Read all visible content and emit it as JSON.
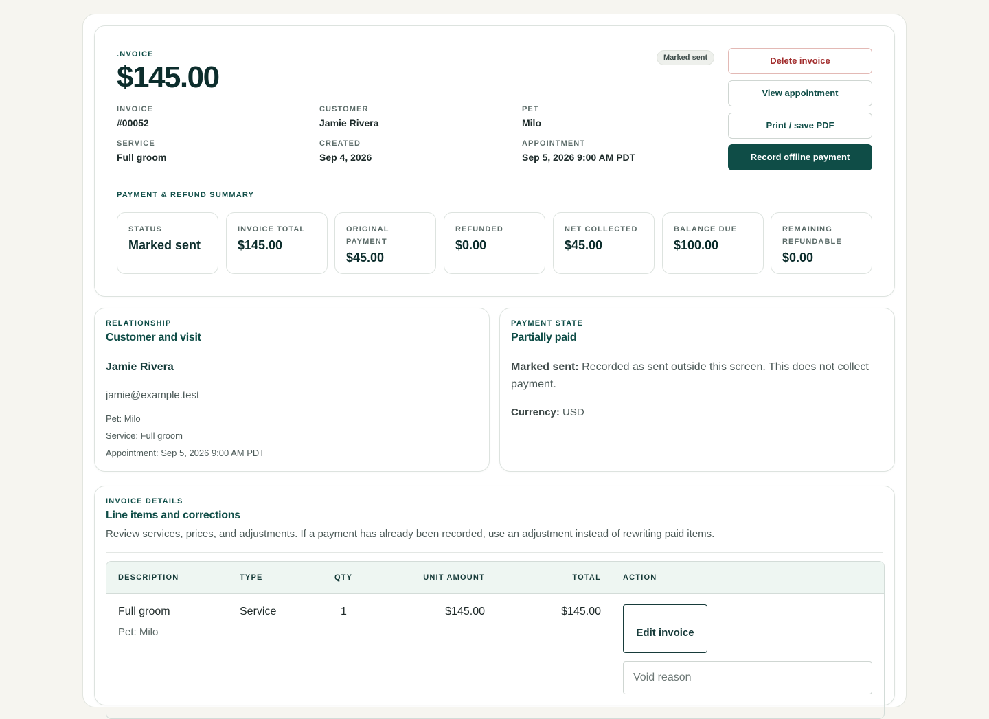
{
  "header": {
    "kicker": ".NVOICE",
    "amount": "$145.00",
    "status_badge": "Marked sent",
    "fields": [
      {
        "label": "INVOICE",
        "value": "#00052"
      },
      {
        "label": "CUSTOMER",
        "value": "Jamie Rivera"
      },
      {
        "label": "PET",
        "value": "Milo"
      },
      {
        "label": "SERVICE",
        "value": "Full groom"
      },
      {
        "label": "CREATED",
        "value": "Sep 4, 2026"
      },
      {
        "label": "APPOINTMENT",
        "value": "Sep 5, 2026 9:00 AM PDT"
      }
    ],
    "actions": {
      "delete": "Delete invoice",
      "view": "View appointment",
      "print": "Print / save PDF",
      "record": "Record offline payment"
    }
  },
  "summary": {
    "title": "PAYMENT & REFUND SUMMARY",
    "stats": [
      {
        "label": "STATUS",
        "value": "Marked sent"
      },
      {
        "label": "INVOICE TOTAL",
        "value": "$145.00"
      },
      {
        "label": "ORIGINAL PAYMENT",
        "value": "$45.00"
      },
      {
        "label": "REFUNDED",
        "value": "$0.00"
      },
      {
        "label": "NET COLLECTED",
        "value": "$45.00"
      },
      {
        "label": "BALANCE DUE",
        "value": "$100.00"
      },
      {
        "label": "REMAINING REFUNDABLE",
        "value": "$0.00"
      }
    ]
  },
  "relationship": {
    "eyebrow": "RELATIONSHIP",
    "title": "Customer and visit",
    "name": "Jamie Rivera",
    "email": "jamie@example.test",
    "pet": "Pet: Milo",
    "service": "Service: Full groom",
    "appointment": "Appointment: Sep 5, 2026 9:00 AM PDT"
  },
  "payment_state": {
    "eyebrow": "PAYMENT STATE",
    "title": "Partially paid",
    "note_label": "Marked sent:",
    "note_text": " Recorded as sent outside this screen. This does not collect payment.",
    "currency_label": "Currency:",
    "currency_value": " USD"
  },
  "details": {
    "eyebrow": "INVOICE DETAILS",
    "title": "Line items and corrections",
    "description": "Review services, prices, and adjustments. If a payment has already been recorded, use an adjustment instead of rewriting paid items.",
    "columns": [
      "DESCRIPTION",
      "TYPE",
      "QTY",
      "UNIT AMOUNT",
      "TOTAL",
      "ACTION"
    ],
    "rows": [
      {
        "description": "Full groom",
        "sub": "Pet: Milo",
        "type": "Service",
        "qty": "1",
        "unit_amount": "$145.00",
        "total": "$145.00",
        "edit_label": "Edit invoice",
        "void_placeholder": "Void reason"
      }
    ]
  }
}
